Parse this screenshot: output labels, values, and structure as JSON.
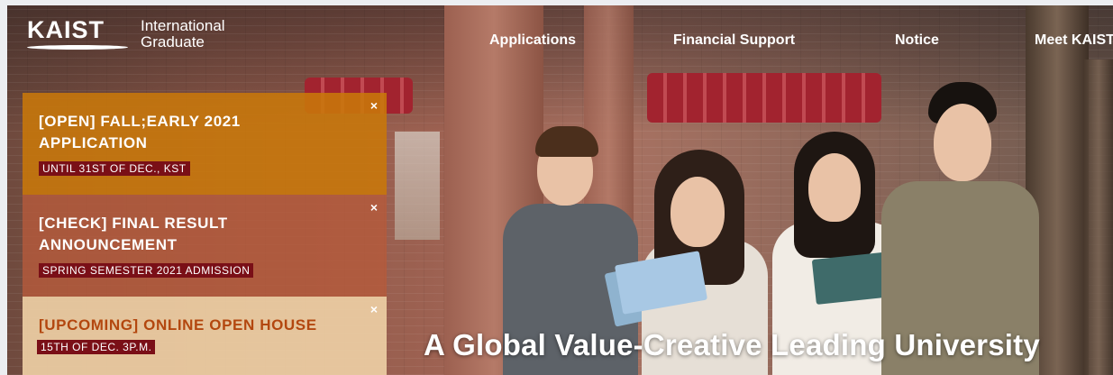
{
  "logo": {
    "mark": "KAIST",
    "line1": "International",
    "line2": "Graduate"
  },
  "nav": [
    {
      "label": "Applications"
    },
    {
      "label": "Financial Support"
    },
    {
      "label": "Notice"
    },
    {
      "label": "Meet KAIST"
    }
  ],
  "notices": [
    {
      "title_line1": "[OPEN] FALL;EARLY 2021",
      "title_line2": "APPLICATION",
      "subtitle": "UNTIL 31ST OF DEC., KST",
      "close": "×"
    },
    {
      "title_line1": "[CHECK] FINAL RESULT",
      "title_line2": "ANNOUNCEMENT",
      "subtitle": "SPRING SEMESTER 2021 ADMISSION",
      "close": "×"
    },
    {
      "title_line1": "[UPCOMING] ONLINE OPEN HOUSE",
      "subtitle": "15TH OF DEC. 3P.M.",
      "close": "×"
    }
  ],
  "hero": {
    "tagline": "A Global Value-Creative Leading University"
  },
  "icons": {
    "close": "close-icon",
    "logo": "kaist-logo"
  },
  "colors": {
    "notice_open": "#c8780a",
    "notice_check": "#b45a3c",
    "notice_upcoming": "#edcea4",
    "badge": "#7a0f17",
    "upcoming_text": "#b3470f"
  }
}
